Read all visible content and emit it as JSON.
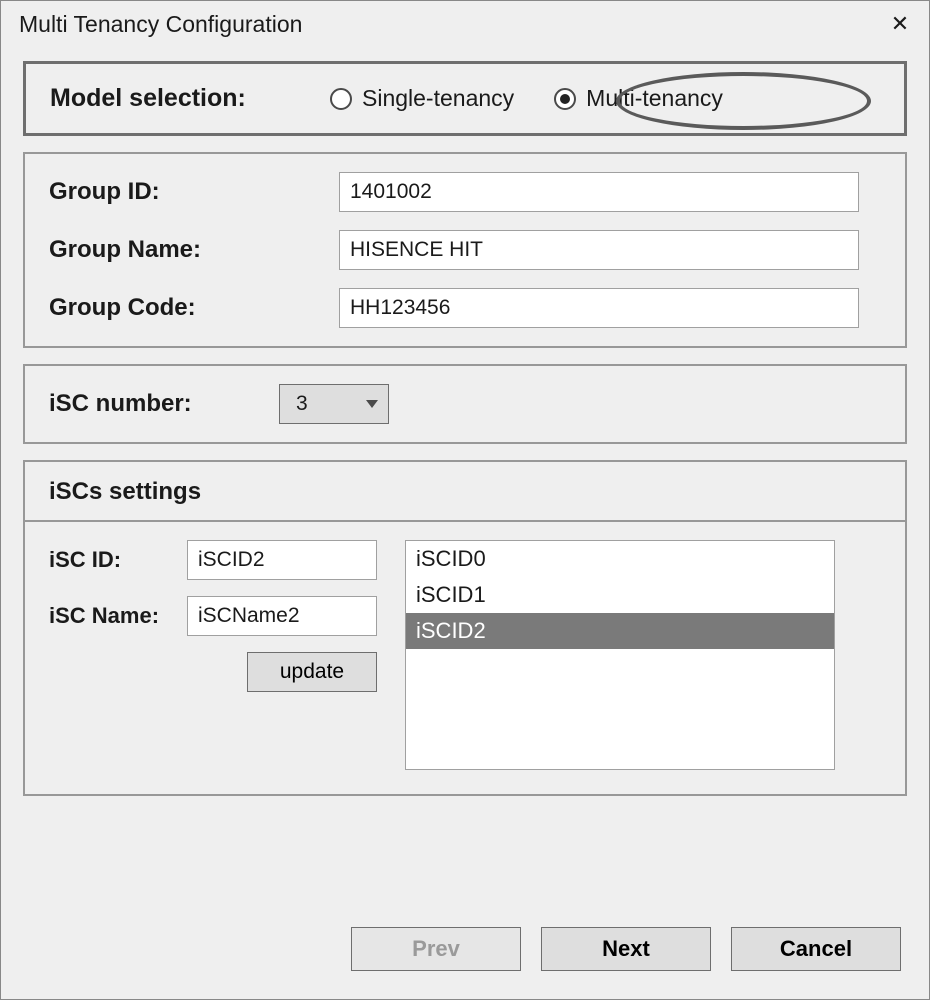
{
  "window": {
    "title": "Multi Tenancy Configuration"
  },
  "model_selection": {
    "label": "Model selection:",
    "options": {
      "single": {
        "label": "Single-tenancy",
        "checked": false
      },
      "multi": {
        "label": "Multi-tenancy",
        "checked": true
      }
    }
  },
  "group": {
    "id_label": "Group ID:",
    "id_value": "1401002",
    "name_label": "Group Name:",
    "name_value": "HISENCE HIT",
    "code_label": "Group Code:",
    "code_value": "HH123456"
  },
  "isc_number": {
    "label": "iSC number:",
    "value": "3"
  },
  "iscs": {
    "header": "iSCs settings",
    "id_label": "iSC ID:",
    "id_value": "iSCID2",
    "name_label": "iSC Name:",
    "name_value": "iSCName2",
    "update_label": "update",
    "list": [
      "iSCID0",
      "iSCID1",
      "iSCID2"
    ],
    "selected_index": 2
  },
  "footer": {
    "prev": "Prev",
    "next": "Next",
    "cancel": "Cancel"
  }
}
